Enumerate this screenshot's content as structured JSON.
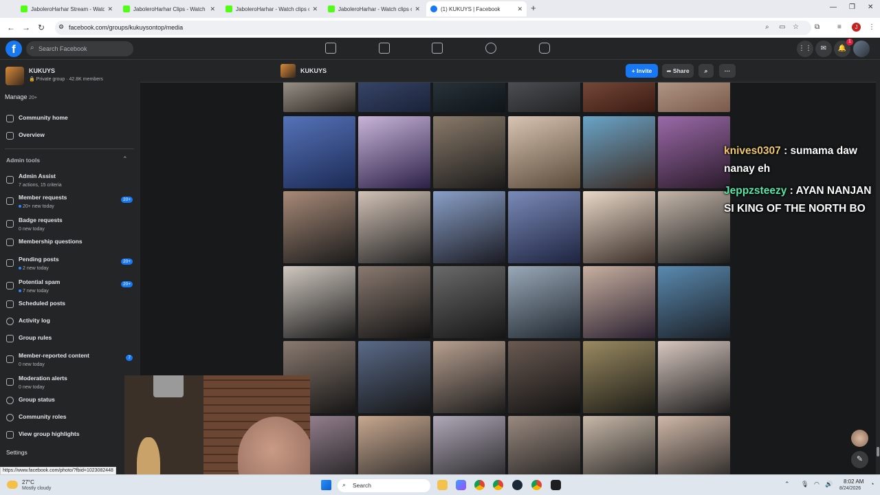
{
  "browser": {
    "tabs": [
      {
        "title": "JaboleroHarhar Stream - Watch",
        "type": "kick"
      },
      {
        "title": "JaboleroHarhar Clips - Watch L",
        "type": "kick"
      },
      {
        "title": "JaboleroHarhar - Watch clips o",
        "type": "kick"
      },
      {
        "title": "JaboleroHarhar - Watch clips o",
        "type": "kick"
      },
      {
        "title": "(1) KUKUYS | Facebook",
        "type": "facebook",
        "active": true
      }
    ],
    "new_tab": "+",
    "url": "facebook.com/groups/kukuysontop/media",
    "status_url": "https://www.facebook.com/photo/?fbid=1023082448"
  },
  "facebook": {
    "logo": "f",
    "search_placeholder": "Search Facebook",
    "notification_count": "1"
  },
  "group": {
    "name": "KUKUYS",
    "meta": "Private group · 42.8K members",
    "manage_label": "Manage",
    "manage_count": "20+"
  },
  "sidebar": {
    "top_items": [
      {
        "label": "Community home",
        "icon": "home-icon"
      },
      {
        "label": "Overview",
        "icon": "layers-icon"
      }
    ],
    "admin_tools_label": "Admin tools",
    "admin_items": [
      {
        "label": "Admin Assist",
        "sub": "7 actions, 15 criteria",
        "icon": "gear-icon"
      },
      {
        "label": "Member requests",
        "sub": "20+ new today",
        "count": "20+",
        "icon": "person-add-icon"
      },
      {
        "label": "Badge requests",
        "sub": "0 new today",
        "icon": "badge-icon"
      },
      {
        "label": "Membership questions",
        "icon": "clipboard-icon"
      },
      {
        "label": "Pending posts",
        "sub": "2 new today",
        "count": "20+",
        "icon": "post-icon"
      },
      {
        "label": "Potential spam",
        "sub": "7 new today",
        "count": "20+",
        "icon": "warning-icon"
      },
      {
        "label": "Scheduled posts",
        "icon": "calendar-icon"
      },
      {
        "label": "Activity log",
        "icon": "clock-icon"
      },
      {
        "label": "Group rules",
        "icon": "book-icon"
      },
      {
        "label": "Member-reported content",
        "sub": "0 new today",
        "count": "7",
        "icon": "flag-icon"
      },
      {
        "label": "Moderation alerts",
        "sub": "0 new today",
        "icon": "alert-icon"
      },
      {
        "label": "Group status",
        "icon": "status-icon"
      },
      {
        "label": "Community roles",
        "icon": "roles-icon"
      },
      {
        "label": "View group highlights",
        "icon": "highlights-icon"
      }
    ],
    "settings_label": "Settings"
  },
  "group_bar": {
    "name": "KUKUYS",
    "invite_label": "+ Invite",
    "share_label": "Share",
    "more_label": "···"
  },
  "chat": [
    {
      "user": "knives0307",
      "message": ": sumama daw nanay eh"
    },
    {
      "user": "Jeppzsteezy",
      "message": ": AYAN NANJAN SI KING OF THE NORTH BO"
    }
  ],
  "taskbar": {
    "temperature": "27°C",
    "weather": "Mostly cloudy",
    "search_label": "Search",
    "time": "8:02 AM",
    "date": "8/24/2026"
  },
  "colors": {
    "fb_blue": "#1877f2",
    "background": "#18191a",
    "surface": "#242526"
  }
}
